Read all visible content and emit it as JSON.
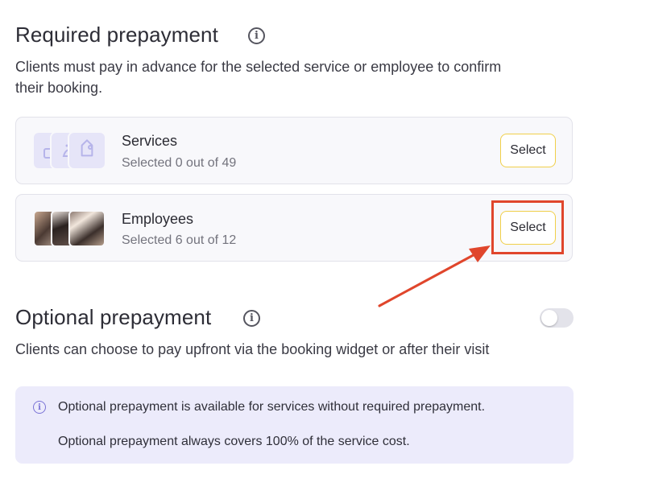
{
  "required": {
    "title": "Required prepayment",
    "description_line1": "Clients must pay in advance for the selected service or employee to confirm",
    "description_line2": "their booking.",
    "services": {
      "title": "Services",
      "subtitle": "Selected 0 out of 49",
      "select_label": "Select",
      "icons": [
        "cake-icon",
        "broom-icon",
        "tag-icon"
      ]
    },
    "employees": {
      "title": "Employees",
      "subtitle": "Selected 6 out of 12",
      "select_label": "Select",
      "avatars": [
        "employee-avatar-1",
        "employee-avatar-2",
        "employee-avatar-3"
      ]
    }
  },
  "optional": {
    "title": "Optional prepayment",
    "description": "Clients can choose to pay upfront via the booking widget or after their visit",
    "toggle_on": false,
    "notice": {
      "line1": "Optional prepayment is available for services without required prepayment.",
      "line2": "Optional prepayment always covers 100% of the service cost."
    }
  },
  "annotation": {
    "color": "#e0462c"
  },
  "colors": {
    "accent_yellow": "#f0cf4a",
    "tile_lavender": "#e6e5f8",
    "notice_bg": "#ecebfb",
    "annotation_red": "#e0462c"
  }
}
